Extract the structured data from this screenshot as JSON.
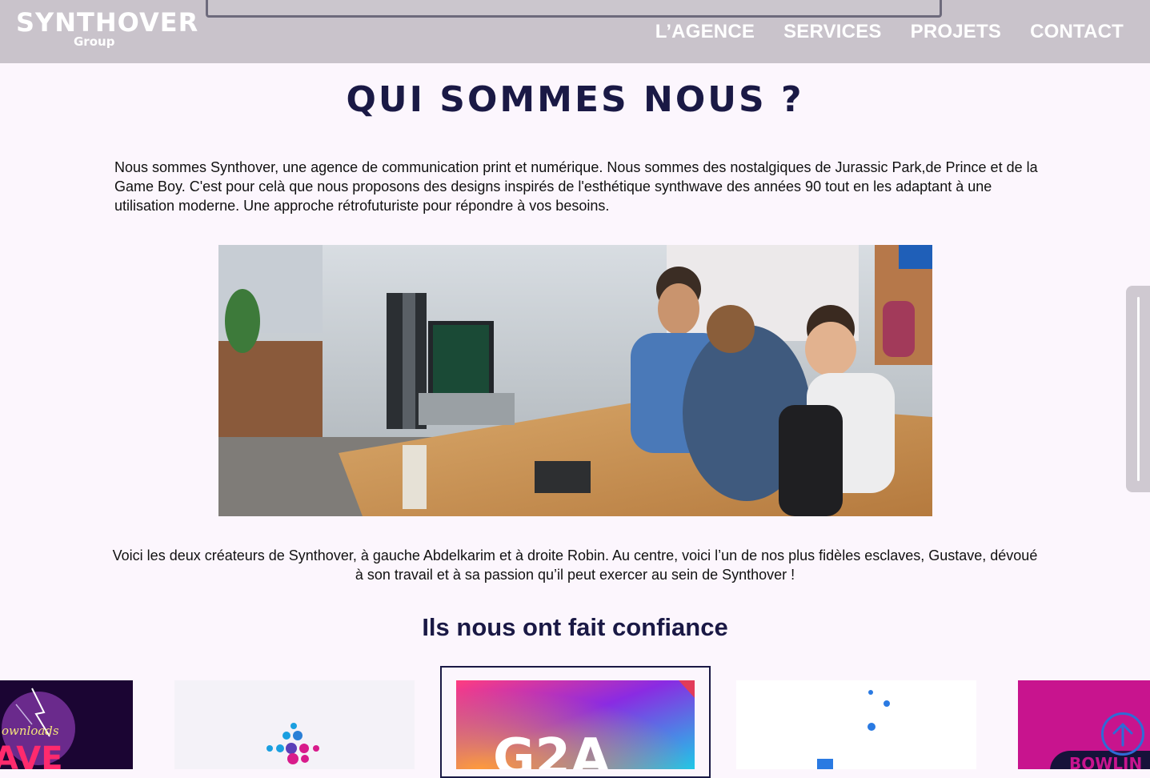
{
  "header": {
    "logo": {
      "name": "SYNTHOVER",
      "sub": "Group"
    },
    "nav": [
      {
        "label": "L’AGENCE"
      },
      {
        "label": "SERVICES"
      },
      {
        "label": "PROJETS"
      },
      {
        "label": "CONTACT"
      }
    ]
  },
  "about": {
    "title": "QUI SOMMES NOUS ?",
    "intro": "Nous sommes Synthover, une agence de communication print et numérique. Nous sommes des nostalgiques de Jurassic Park,de Prince et de la Game Boy. C'est pour celà que nous proposons des designs inspirés de l'esthétique synthwave des années 90 tout en les adaptant à une utilisation moderne. Une approche rétrofuturiste pour répondre à vos besoins.",
    "photo_caption": "Voici les deux créateurs de Synthover, à gauche Abdelkarim et à droite Robin. Au centre, voici l’un de nos plus fidèles esclaves, Gustave, dévoué à son travail et à sa passion qu’il peut exercer au sein de Synthover !"
  },
  "clients": {
    "heading": "Ils nous ont fait confiance",
    "logos": [
      {
        "text": "ownloads",
        "brand_text": "AVE",
        "colors": [
          "#1b0533",
          "#ff2a6d"
        ]
      },
      {
        "icon": "dots-logo-icon",
        "colors": [
          "#f4f2f8",
          "#1a9fe0",
          "#d81b8b"
        ]
      },
      {
        "text": "G2A",
        "colors": [
          "#8a2be2",
          "#ff5e62",
          "#1ec8e8"
        ]
      },
      {
        "icon": "dots-logo-icon",
        "colors": [
          "#ffffff",
          "#2a7ae2"
        ]
      },
      {
        "text": "BOWLIN",
        "colors": [
          "#c8148e",
          "#16123a"
        ]
      }
    ]
  },
  "controls": {
    "back_to_top_icon": "arrow-up-icon",
    "accent": "#2f6bd6"
  }
}
